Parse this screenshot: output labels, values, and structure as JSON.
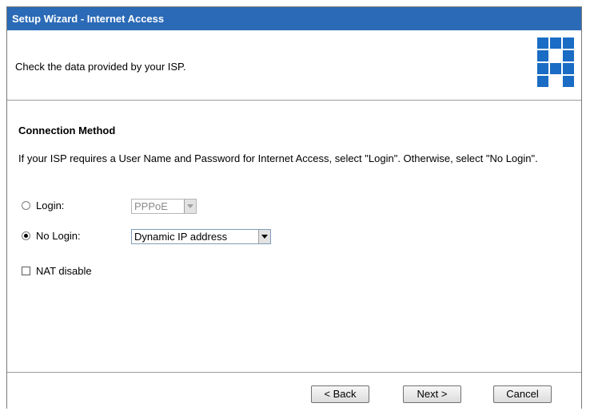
{
  "window": {
    "title": "Setup Wizard - Internet Access"
  },
  "header": {
    "instruction": "Check the data provided by your ISP."
  },
  "section": {
    "title": "Connection Method",
    "description": "If your ISP requires a User Name and Password for Internet Access, select \"Login\". Otherwise, select \"No Login\"."
  },
  "options": {
    "login": {
      "label": "Login:",
      "selected": false,
      "select_value": "PPPoE",
      "select_disabled": true
    },
    "no_login": {
      "label": "No Login:",
      "selected": true,
      "select_value": "Dynamic IP address",
      "select_disabled": false
    },
    "nat_disable": {
      "label": "NAT disable",
      "checked": false
    }
  },
  "buttons": {
    "back": "< Back",
    "next": "Next >",
    "cancel": "Cancel"
  },
  "colors": {
    "titlebar": "#2b6ab6",
    "logo": "#1a6cc4"
  },
  "icons": {
    "logo": "levelone-logo-icon"
  }
}
